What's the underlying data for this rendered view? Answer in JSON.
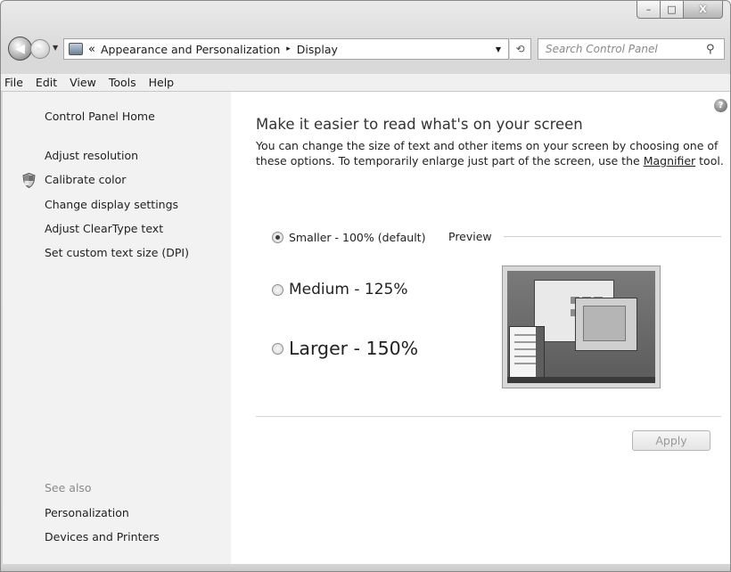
{
  "window": {
    "caption": {
      "minimize": "–",
      "maximize": "□",
      "close": "X"
    }
  },
  "address": {
    "chevron": "«",
    "crumbs": [
      "Appearance and Personalization",
      "Display"
    ],
    "separator": "▸"
  },
  "search": {
    "placeholder": "Search Control Panel"
  },
  "menu": [
    "File",
    "Edit",
    "View",
    "Tools",
    "Help"
  ],
  "sidebar": {
    "home": "Control Panel Home",
    "tasks": [
      "Adjust resolution",
      "Calibrate color",
      "Change display settings",
      "Adjust ClearType text",
      "Set custom text size (DPI)"
    ],
    "see_also_label": "See also",
    "see_also": [
      "Personalization",
      "Devices and Printers"
    ]
  },
  "main": {
    "heading": "Make it easier to read what's on your screen",
    "description": "You can change the size of text and other items on your screen by choosing one of these options. To temporarily enlarge just part of the screen, use the",
    "link": "Magnifier",
    "description_end": "tool.",
    "options": [
      {
        "label": "Smaller - 100% (default)",
        "checked": true
      },
      {
        "label": "Medium - 125%",
        "checked": false
      },
      {
        "label": "Larger - 150%",
        "checked": false
      }
    ],
    "preview_label": "Preview",
    "apply_label": "Apply"
  },
  "icons": {
    "back": "back-arrow-icon",
    "forward": "forward-arrow-icon",
    "refresh": "refresh-icon",
    "search": "search-icon",
    "help": "help-icon",
    "shield": "shield-icon"
  },
  "colors": {
    "content_bg": "#ffffff",
    "sidebar_bg": "#f2f2f2",
    "chrome": "#d9d9d9"
  }
}
